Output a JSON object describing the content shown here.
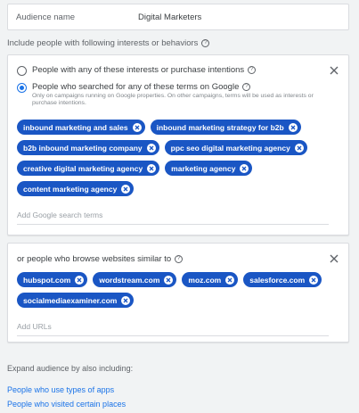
{
  "audience": {
    "name_label": "Audience name",
    "name_value": "Digital Marketers"
  },
  "include_header": "Include people with following interests or behaviors",
  "options": {
    "interests_label": "People with any of these interests or purchase intentions",
    "search_label": "People who searched for any of these terms on Google",
    "search_note": "Only on campaigns running on Google properties. On other campaigns, terms will be used as interests or purchase intentions.",
    "selected": "search"
  },
  "search_terms": [
    "inbound marketing and sales",
    "inbound marketing strategy for b2b",
    "b2b inbound marketing company",
    "ppc seo digital marketing agency",
    "creative digital marketing agency",
    "marketing agency",
    "content marketing agency"
  ],
  "search_input": {
    "placeholder": "Add Google search terms"
  },
  "websites": {
    "title": "or people who browse websites similar to",
    "urls": [
      "hubspot.com",
      "wordstream.com",
      "moz.com",
      "salesforce.com",
      "socialmediaexaminer.com"
    ],
    "placeholder": "Add URLs"
  },
  "expand": {
    "label": "Expand audience by also including:",
    "links": [
      "People who use types of apps",
      "People who visited certain places"
    ]
  },
  "colors": {
    "chip": "#1a56c4",
    "accent": "#1a73e8"
  },
  "icons": {
    "help": "help-circle-icon",
    "close": "close-icon",
    "chip_remove": "chip-remove-icon"
  }
}
